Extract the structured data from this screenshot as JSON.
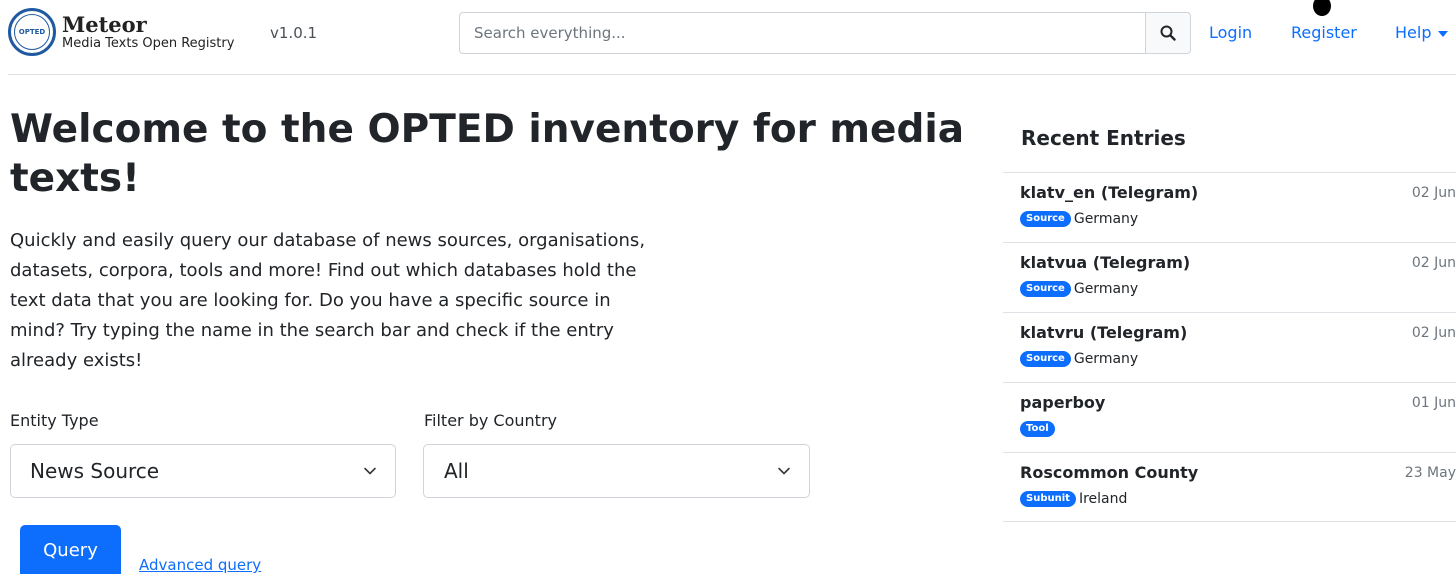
{
  "brand": {
    "logo_text": "OPTED",
    "title": "Meteor",
    "subtitle": "Media Texts Open Registry",
    "version": "v1.0.1"
  },
  "search": {
    "placeholder": "Search everything...",
    "icon": "search-icon"
  },
  "nav": {
    "login": "Login",
    "register": "Register",
    "help": "Help"
  },
  "hero": {
    "title": "Welcome to the OPTED inventory for media texts!",
    "lead": "Quickly and easily query our database of news sources, organisations, datasets, corpora, tools and more! Find out which databases hold the text data that you are looking for. Do you have a specific source in mind? Try typing the name in the search bar and check if the entry already exists!"
  },
  "filters": {
    "entity_label": "Entity Type",
    "entity_value": "News Source",
    "country_label": "Filter by Country",
    "country_value": "All"
  },
  "actions": {
    "query": "Query",
    "advanced": "Advanced query"
  },
  "recent": {
    "title": "Recent Entries",
    "items": [
      {
        "name": "klatv_en (Telegram)",
        "date": "02 Jun",
        "badge": "Source",
        "country": "Germany"
      },
      {
        "name": "klatvua (Telegram)",
        "date": "02 Jun",
        "badge": "Source",
        "country": "Germany"
      },
      {
        "name": "klatvru (Telegram)",
        "date": "02 Jun",
        "badge": "Source",
        "country": "Germany"
      },
      {
        "name": "paperboy",
        "date": "01 Jun",
        "badge": "Tool",
        "country": ""
      },
      {
        "name": "Roscommon County",
        "date": "23 May",
        "badge": "Subunit",
        "country": "Ireland"
      }
    ]
  },
  "colors": {
    "accent": "#0d6efd",
    "logo": "#1f5aa0"
  }
}
